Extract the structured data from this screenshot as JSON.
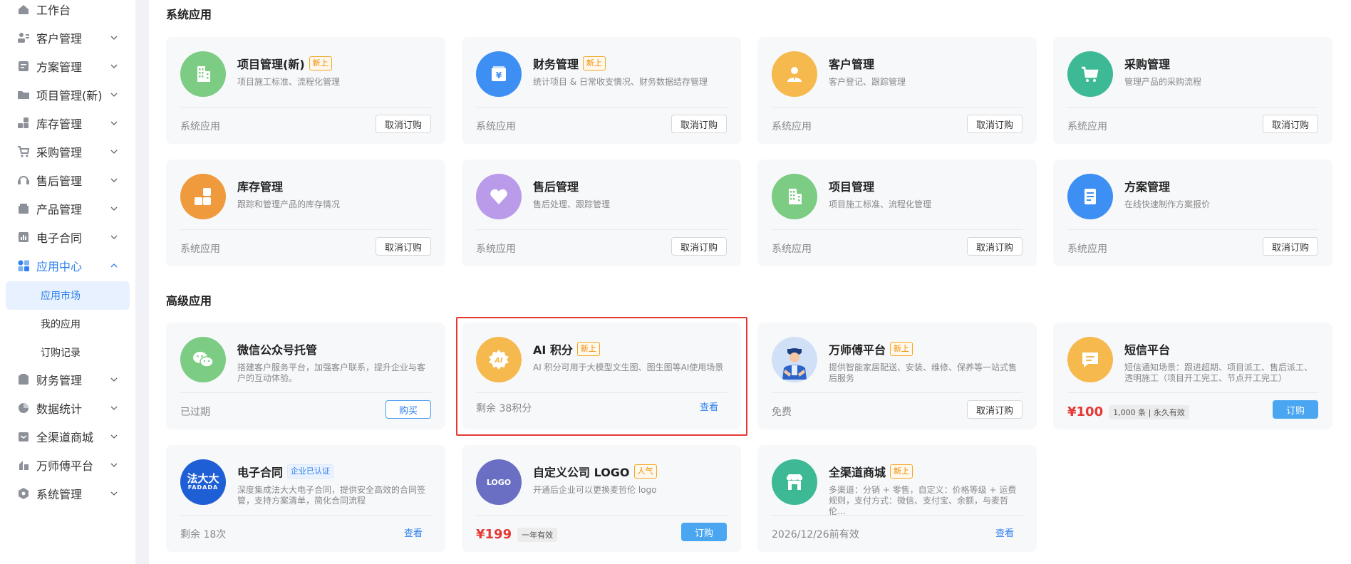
{
  "sidebar": {
    "items": [
      {
        "label": "工作台",
        "icon": "home-icon"
      },
      {
        "label": "客户管理",
        "icon": "customer-icon"
      },
      {
        "label": "方案管理",
        "icon": "document-icon"
      },
      {
        "label": "项目管理(新)",
        "icon": "folder-icon"
      },
      {
        "label": "库存管理",
        "icon": "inventory-icon"
      },
      {
        "label": "采购管理",
        "icon": "cart-icon"
      },
      {
        "label": "售后管理",
        "icon": "headset-icon"
      },
      {
        "label": "产品管理",
        "icon": "product-icon"
      },
      {
        "label": "电子合同",
        "icon": "contract-icon"
      },
      {
        "label": "应用中心",
        "icon": "apps-icon"
      },
      {
        "label": "财务管理",
        "icon": "wallet-icon"
      },
      {
        "label": "数据统计",
        "icon": "pie-chart-icon"
      },
      {
        "label": "全渠道商城",
        "icon": "store-icon"
      },
      {
        "label": "万师傅平台",
        "icon": "worker-icon"
      },
      {
        "label": "系统管理",
        "icon": "settings-icon"
      }
    ],
    "sub_items": [
      {
        "label": "应用市场"
      },
      {
        "label": "我的应用"
      },
      {
        "label": "订购记录"
      }
    ]
  },
  "sections": {
    "system_title": "系统应用",
    "advanced_title": "高级应用"
  },
  "cards": [
    {
      "name": "项目管理(新)",
      "badge": "新上",
      "desc": "项目施工标准、流程化管理",
      "foot": "系统应用",
      "action": "取消订购",
      "color": "#7dcc84",
      "icon": "building-icon"
    },
    {
      "name": "财务管理",
      "badge": "新上",
      "desc": "统计项目 & 日常收支情况、财务数据结存管理",
      "foot": "系统应用",
      "action": "取消订购",
      "color": "#3d8ff3",
      "icon": "yuan-icon"
    },
    {
      "name": "客户管理",
      "badge": "",
      "desc": "客户登记、跟踪管理",
      "foot": "系统应用",
      "action": "取消订购",
      "color": "#f5b94e",
      "icon": "person-icon"
    },
    {
      "name": "采购管理",
      "badge": "",
      "desc": "管理产品的采购流程",
      "foot": "系统应用",
      "action": "取消订购",
      "color": "#3dba95",
      "icon": "cart-icon"
    },
    {
      "name": "库存管理",
      "badge": "",
      "desc": "跟踪和管理产品的库存情况",
      "foot": "系统应用",
      "action": "取消订购",
      "color": "#ef9a3c",
      "icon": "boxes-icon"
    },
    {
      "name": "售后管理",
      "badge": "",
      "desc": "售后处理、跟踪管理",
      "foot": "系统应用",
      "action": "取消订购",
      "color": "#b99bea",
      "icon": "heart-icon"
    },
    {
      "name": "项目管理",
      "badge": "",
      "desc": "项目施工标准、流程化管理",
      "foot": "系统应用",
      "action": "取消订购",
      "color": "#7dcc84",
      "icon": "building-icon"
    },
    {
      "name": "方案管理",
      "badge": "",
      "desc": "在线快速制作方案报价",
      "foot": "系统应用",
      "action": "取消订购",
      "color": "#3d8ff3",
      "icon": "document-icon"
    }
  ],
  "advanced_cards": [
    {
      "name": "微信公众号托管",
      "badge": "",
      "desc": "搭建客户服务平台，加强客户联系，提升企业与客户的互动体验。",
      "foot": "已过期",
      "action": "购买",
      "color": "#7dcc84",
      "icon": "wechat-icon"
    },
    {
      "name": "AI 积分",
      "badge": "新上",
      "desc": "AI 积分可用于大模型文生图、图生图等AI使用场景",
      "foot": "剩余 38积分",
      "action": "查看",
      "color": "#f5b94e",
      "icon": "ai-badge-icon"
    },
    {
      "name": "万师傅平台",
      "badge": "新上",
      "desc": "提供智能家居配送、安装、维修、保养等一站式售后服务",
      "foot": "免费",
      "action": "取消订购",
      "color": "#cfe0f7",
      "icon": "worker-icon"
    },
    {
      "name": "短信平台",
      "badge": "",
      "desc": "短信通知场景：跟进超期、项目派工、售后派工、透明施工（项目开工完工、节点开工完工）",
      "price": "¥100",
      "price_tag": "1,000 条 | 永久有效",
      "action": "订购",
      "color": "#f5b94e",
      "icon": "message-icon"
    },
    {
      "name": "电子合同",
      "badge": "企业已认证",
      "desc": "深度集成法大大电子合同，提供安全高效的合同签管，支持方案清单，简化合同流程",
      "foot": "剩余 18次",
      "action": "查看",
      "color": "#1f5fd6",
      "icon": "fadada-logo-icon",
      "logo_text": "法大大",
      "logo_sub": "FADADA"
    },
    {
      "name": "自定义公司 LOGO",
      "badge": "人气",
      "desc": "开通后企业可以更换麦哲伦 logo",
      "price": "¥199",
      "price_tag": "一年有效",
      "action": "订购",
      "color": "#6b6fc4",
      "icon": "logo-icon",
      "logo_text": "LOGO"
    },
    {
      "name": "全渠道商城",
      "badge": "新上",
      "desc": "多渠道：分销 + 零售，自定义：价格等级 + 运费规则，支付方式：微信、支付宝、余额，与麦哲伦…",
      "foot": "2026/12/26前有效",
      "action": "查看",
      "color": "#3dba95",
      "icon": "store-icon"
    }
  ]
}
